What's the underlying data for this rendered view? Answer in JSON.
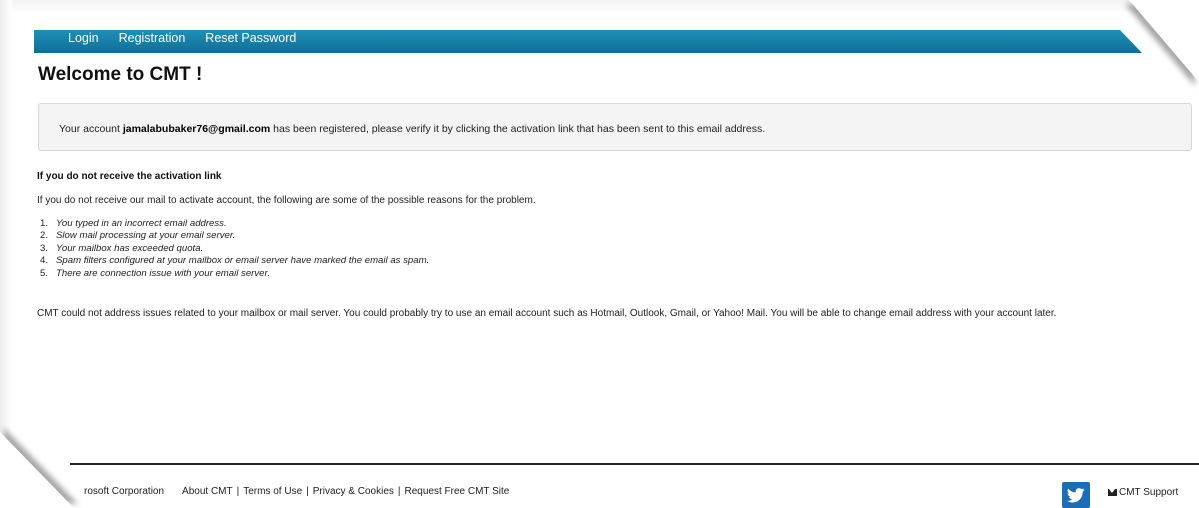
{
  "nav": {
    "items": [
      {
        "label": "Login"
      },
      {
        "label": "Registration"
      },
      {
        "label": "Reset Password"
      }
    ]
  },
  "page": {
    "title": "Welcome to CMT !"
  },
  "alert": {
    "prefix": "Your account ",
    "email": "jamalabubaker76@gmail.com",
    "suffix": " has been registered, please verify it by clicking the activation link that has been sent to this email address."
  },
  "help": {
    "heading": "If you do not receive the activation link",
    "intro": "If you do not receive our mail to activate account, the following are some of the possible reasons for the problem.",
    "reasons": [
      {
        "num": "1.",
        "text": "You typed in an incorrect email address."
      },
      {
        "num": "2.",
        "text": "Slow mail processing at your email server."
      },
      {
        "num": "3.",
        "text": "Your mailbox has exceeded quota."
      },
      {
        "num": "4.",
        "text": "Spam filters configured at your mailbox or email server have marked the email as spam."
      },
      {
        "num": "5.",
        "text": "There are connection issue with your email server."
      }
    ],
    "note": "CMT could not address issues related to your mailbox or mail server. You could probably try to use an email account such as Hotmail, Outlook, Gmail, or Yahoo! Mail. You will be able to change email address with your account later."
  },
  "footer": {
    "copyright": "rosoft Corporation",
    "links": [
      {
        "label": "About CMT"
      },
      {
        "label": "Terms of Use"
      },
      {
        "label": "Privacy & Cookies"
      },
      {
        "label": "Request Free CMT Site"
      }
    ],
    "separator": "|",
    "twitter_icon": "twitter-icon",
    "support_label": "CMT Support",
    "support_icon": "mail-icon"
  },
  "colors": {
    "nav_bar": "#1784ad",
    "twitter": "#1b6eb5",
    "alert_bg": "#f4f4f4"
  }
}
